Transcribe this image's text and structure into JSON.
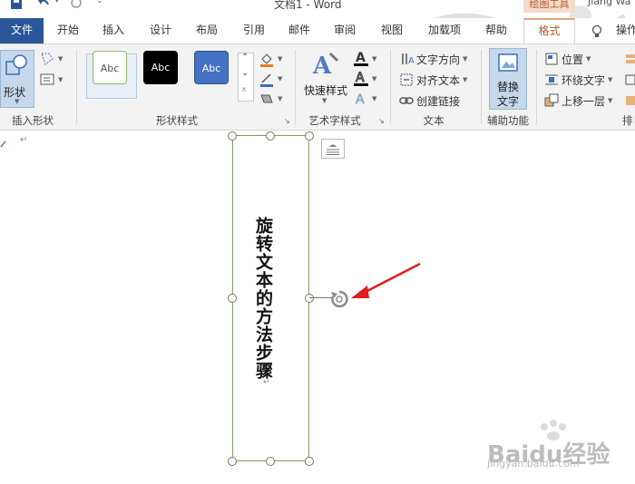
{
  "titlebar": {
    "title": "文档1 - Word",
    "context_tools": "绘图工具",
    "user": "Jiang Wa"
  },
  "tabs": [
    "文件",
    "开始",
    "插入",
    "设计",
    "布局",
    "引用",
    "邮件",
    "审阅",
    "视图",
    "加载项",
    "帮助",
    "格式",
    "操作"
  ],
  "ribbon": {
    "insert_shapes": {
      "label": "插入形状",
      "shape_btn": "形状"
    },
    "shape_styles": {
      "label": "形状样式",
      "swatches": [
        "Abc",
        "Abc",
        "Abc"
      ]
    },
    "wordart": {
      "label": "艺术字样式",
      "quick_styles": "快速样式"
    },
    "text": {
      "label": "文本",
      "direction": "文字方向",
      "align": "对齐文本",
      "link": "创建链接"
    },
    "accessibility": {
      "label": "辅助功能",
      "alt_text_1": "替换",
      "alt_text_2": "文字"
    },
    "arrange": {
      "label": "排",
      "position": "位置",
      "wrap": "环绕文字",
      "bring_forward": "上移一层"
    }
  },
  "document": {
    "text_box_content": "旋转文本的方法步骤",
    "paragraph_mark": "↵",
    "watermark": "Baidu经验",
    "watermark_url": "jingyan.baidu.com"
  },
  "colors": {
    "file_tab": "#2b579a",
    "format_tab": "#b8582a",
    "shape_border": "#7fa061",
    "arrow": "#e01e1e"
  }
}
